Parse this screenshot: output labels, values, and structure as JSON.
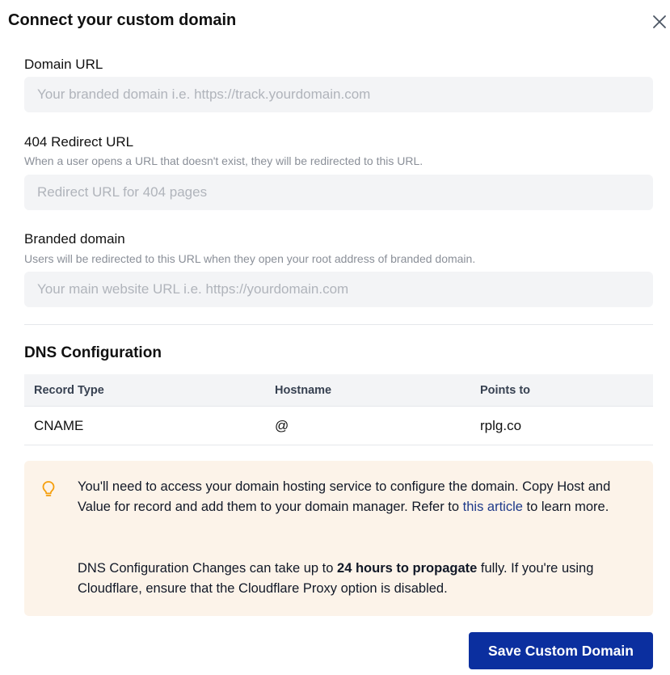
{
  "modal": {
    "title": "Connect your custom domain",
    "close_icon": "close-icon"
  },
  "fields": {
    "domain_url": {
      "label": "Domain URL",
      "value": "",
      "placeholder": "Your branded domain i.e. https://track.yourdomain.com"
    },
    "redirect_404": {
      "label": "404 Redirect URL",
      "help": "When a user opens a URL that doesn't exist, they will be redirected to this URL.",
      "value": "",
      "placeholder": "Redirect URL for 404 pages"
    },
    "branded_domain": {
      "label": "Branded domain",
      "help": "Users will be redirected to this URL when they open your root address of branded domain.",
      "value": "",
      "placeholder": "Your main website URL i.e. https://yourdomain.com"
    }
  },
  "dns": {
    "title": "DNS Configuration",
    "columns": [
      "Record Type",
      "Hostname",
      "Points to"
    ],
    "rows": [
      {
        "record_type": "CNAME",
        "hostname": "@",
        "points_to": "rplg.co"
      }
    ]
  },
  "info": {
    "icon": "lightbulb-icon",
    "para1_before": "You'll need to access your domain hosting service to configure the domain. Copy Host and Value for record and add them to your domain manager. Refer to ",
    "para1_link": "this article",
    "para1_after": " to learn more.",
    "para2_before": "DNS Configuration Changes can take up to ",
    "para2_bold": "24 hours to propagate",
    "para2_after": " fully. If you're using Cloudflare, ensure that the Cloudflare Proxy option is disabled."
  },
  "actions": {
    "save_label": "Save Custom Domain"
  },
  "colors": {
    "primary": "#0b2f9f",
    "link": "#1e3a8a",
    "info_bg": "#fcf3e9",
    "info_icon": "#f59e0b",
    "input_bg": "#f3f4f6"
  }
}
